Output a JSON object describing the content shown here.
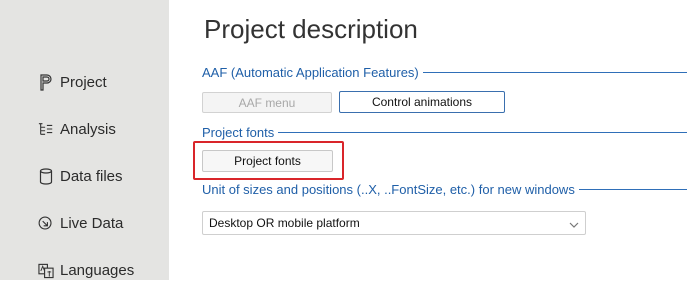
{
  "sidebar": {
    "items": [
      {
        "label": "Project",
        "icon": "project-p-icon"
      },
      {
        "label": "Analysis",
        "icon": "analysis-tree-icon"
      },
      {
        "label": "Data files",
        "icon": "database-icon"
      },
      {
        "label": "Live Data",
        "icon": "live-data-icon"
      },
      {
        "label": "Languages",
        "icon": "languages-icon"
      }
    ]
  },
  "main": {
    "title": "Project description",
    "sections": {
      "aaf": {
        "label": "AAF (Automatic Application Features)",
        "buttons": {
          "aaf_menu": "AAF menu",
          "control_animations": "Control animations"
        }
      },
      "fonts": {
        "label": "Project fonts",
        "buttons": {
          "project_fonts": "Project fonts"
        }
      },
      "units": {
        "label": "Unit of sizes and positions (..X, ..FontSize, etc.) for new windows",
        "selected": "Desktop OR mobile platform"
      }
    }
  },
  "colors": {
    "accent": "#2f6fb8",
    "highlight_box": "#d9252a",
    "sidebar_bg": "#e4e4e2"
  }
}
